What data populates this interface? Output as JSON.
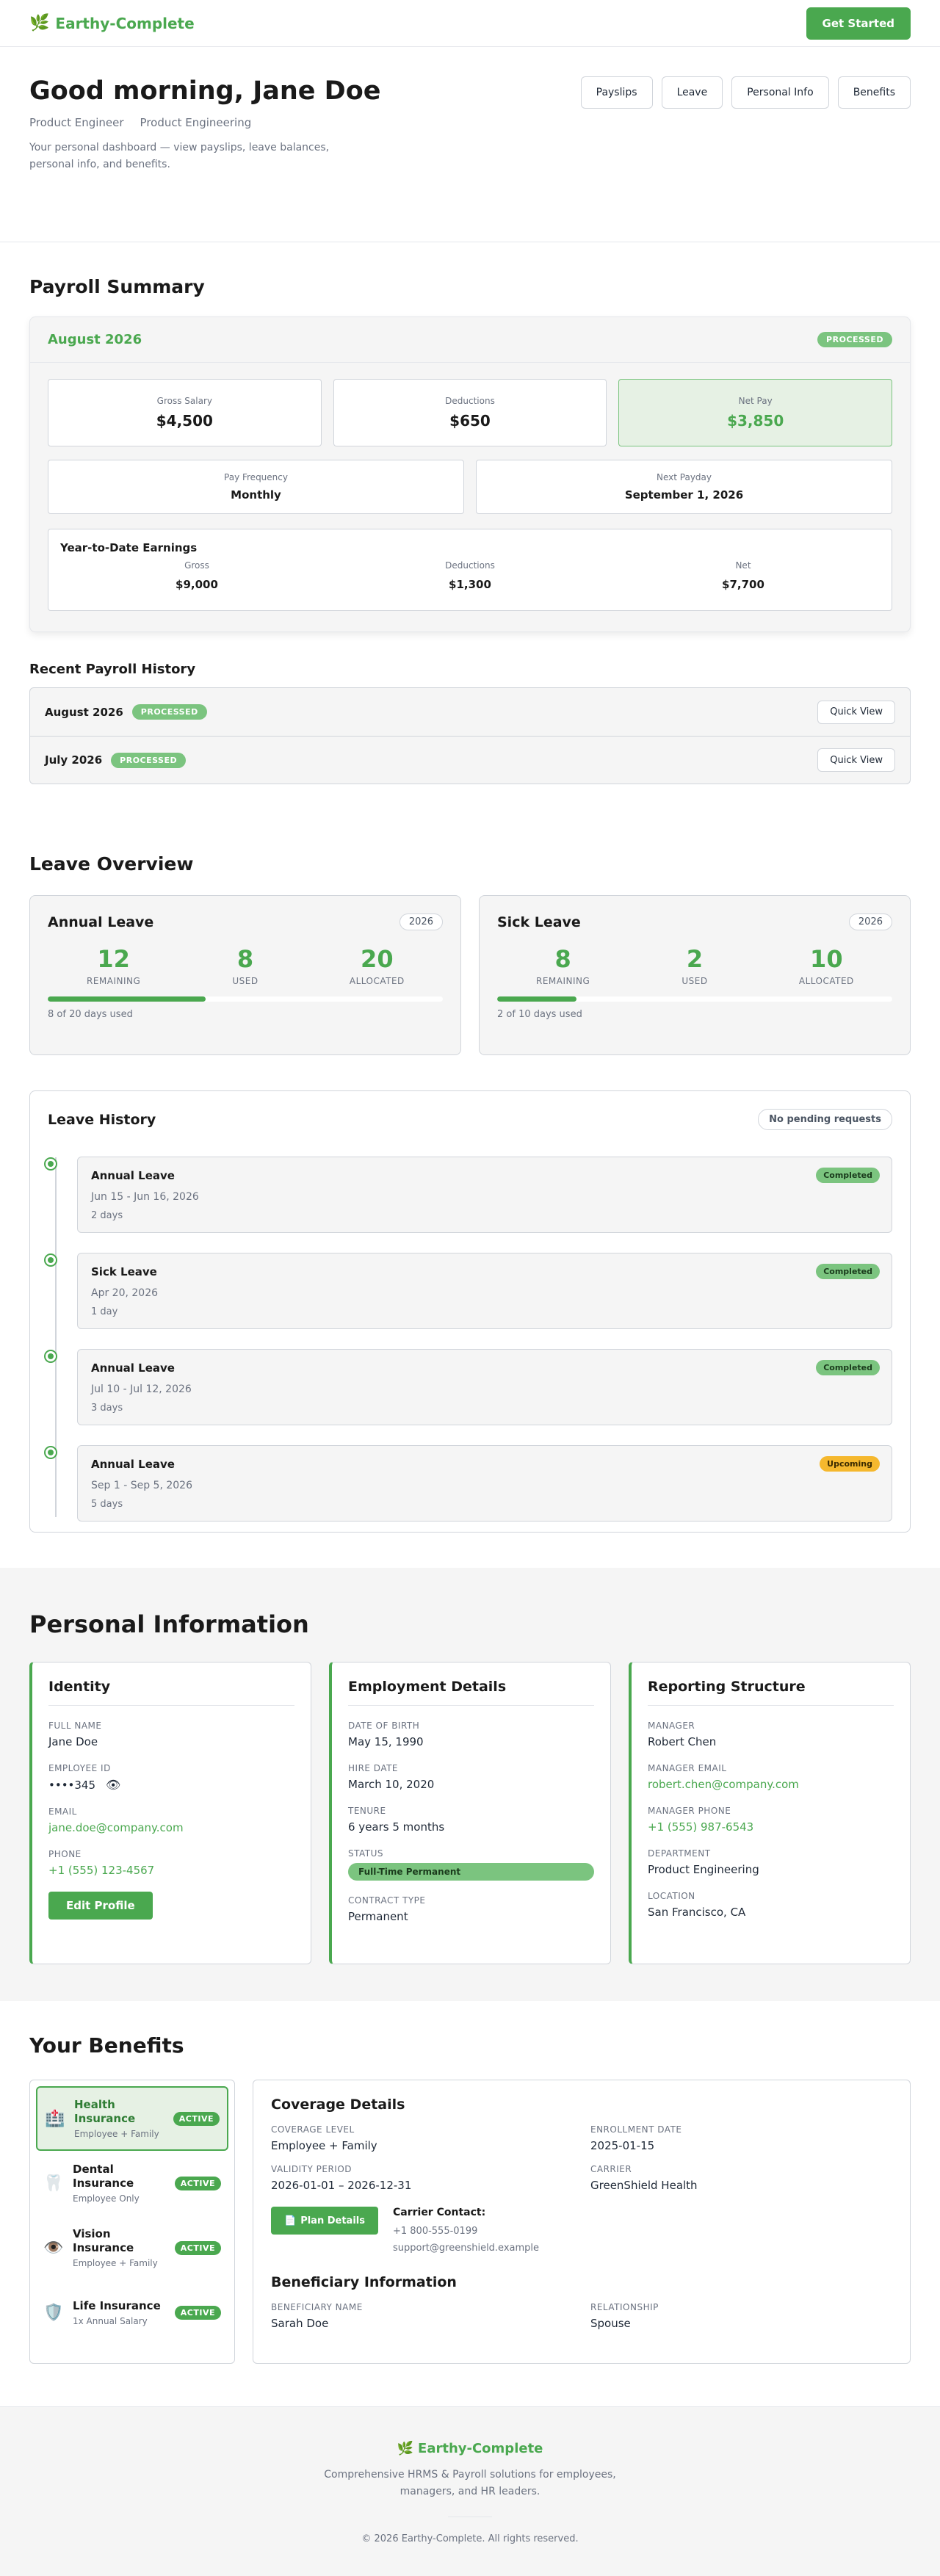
{
  "nav": {
    "brand": "Earthy-Complete",
    "cta": "Get Started"
  },
  "hero": {
    "greeting": "Good morning, Jane Doe",
    "role": "Product Engineer",
    "department": "Product Engineering",
    "description": "Your personal dashboard — view payslips, leave balances, personal info, and benefits.",
    "tabs": [
      "Payslips",
      "Leave",
      "Personal Info",
      "Benefits"
    ]
  },
  "payroll": {
    "title": "Payroll Summary",
    "month": "August 2026",
    "status": "PROCESSED",
    "gross_label": "Gross Salary",
    "gross": "$4,500",
    "deductions_label": "Deductions",
    "deductions": "$650",
    "net_label": "Net Pay",
    "net": "$3,850",
    "frequency_label": "Pay Frequency",
    "frequency": "Monthly",
    "payday_label": "Next Payday",
    "payday": "September 1, 2026",
    "ytd": {
      "title": "Year-to-Date Earnings",
      "gross_label": "Gross",
      "gross": "$9,000",
      "deductions_label": "Deductions",
      "deductions": "$1,300",
      "net_label": "Net",
      "net": "$7,700"
    },
    "history_title": "Recent Payroll History",
    "history": [
      {
        "month": "August 2026",
        "status": "PROCESSED",
        "action": "Quick View"
      },
      {
        "month": "July 2026",
        "status": "PROCESSED",
        "action": "Quick View"
      }
    ]
  },
  "leave": {
    "title": "Leave Overview",
    "cards": [
      {
        "name": "Annual Leave",
        "year": "2026",
        "remaining": "12",
        "used": "8",
        "allocated": "20",
        "remaining_label": "REMAINING",
        "used_label": "USED",
        "allocated_label": "ALLOCATED",
        "progress": 0.4,
        "note": "8 of 20 days used"
      },
      {
        "name": "Sick Leave",
        "year": "2026",
        "remaining": "8",
        "used": "2",
        "allocated": "10",
        "remaining_label": "REMAINING",
        "used_label": "USED",
        "allocated_label": "ALLOCATED",
        "progress": 0.2,
        "note": "2 of 10 days used"
      }
    ],
    "history_title": "Leave History",
    "pending": "No pending requests",
    "history": [
      {
        "type": "Annual Leave",
        "dates": "Jun 15 - Jun 16, 2026",
        "days": "2 days",
        "status": "Completed"
      },
      {
        "type": "Sick Leave",
        "dates": "Apr 20, 2026",
        "days": "1 day",
        "status": "Completed"
      },
      {
        "type": "Annual Leave",
        "dates": "Jul 10 - Jul 12, 2026",
        "days": "3 days",
        "status": "Completed"
      },
      {
        "type": "Annual Leave",
        "dates": "Sep 1 - Sep 5, 2026",
        "days": "5 days",
        "status": "Upcoming"
      }
    ]
  },
  "personal": {
    "title": "Personal Information",
    "identity": {
      "title": "Identity",
      "full_name_label": "FULL NAME",
      "full_name": "Jane Doe",
      "employee_id_label": "EMPLOYEE ID",
      "employee_id": "••••345",
      "email_label": "EMAIL",
      "email": "jane.doe@company.com",
      "phone_label": "PHONE",
      "phone": "+1 (555) 123-4567",
      "edit": "Edit Profile"
    },
    "employment": {
      "title": "Employment Details",
      "dob_label": "DATE OF BIRTH",
      "dob": "May 15, 1990",
      "hire_label": "HIRE DATE",
      "hire": "March 10, 2020",
      "tenure_label": "TENURE",
      "tenure": "6 years 5 months",
      "status_label": "STATUS",
      "status": "Full-Time Permanent",
      "contract_label": "CONTRACT TYPE",
      "contract": "Permanent"
    },
    "reporting": {
      "title": "Reporting Structure",
      "manager_label": "MANAGER",
      "manager": "Robert Chen",
      "manager_email_label": "MANAGER EMAIL",
      "manager_email": "robert.chen@company.com",
      "manager_phone_label": "MANAGER PHONE",
      "manager_phone": "+1 (555) 987-6543",
      "department_label": "DEPARTMENT",
      "department": "Product Engineering",
      "location_label": "LOCATION",
      "location": "San Francisco, CA"
    }
  },
  "benefits": {
    "title": "Your Benefits",
    "items": [
      {
        "icon": "hospital-icon",
        "glyph": "🏥",
        "name": "Health Insurance",
        "sub": "Employee + Family",
        "status": "ACTIVE"
      },
      {
        "icon": "tooth-icon",
        "glyph": "🦷",
        "name": "Dental Insurance",
        "sub": "Employee Only",
        "status": "ACTIVE"
      },
      {
        "icon": "eye-icon",
        "glyph": "👁️",
        "name": "Vision Insurance",
        "sub": "Employee + Family",
        "status": "ACTIVE"
      },
      {
        "icon": "shield-icon",
        "glyph": "🛡️",
        "name": "Life Insurance",
        "sub": "1x Annual Salary",
        "status": "ACTIVE"
      }
    ],
    "detail": {
      "title": "Coverage Details",
      "coverage_label": "COVERAGE LEVEL",
      "coverage": "Employee + Family",
      "enrollment_label": "ENROLLMENT DATE",
      "enrollment": "2025-01-15",
      "validity_label": "VALIDITY PERIOD",
      "validity": "2026-01-01 – 2026-12-31",
      "carrier_label": "CARRIER",
      "carrier": "GreenShield Health",
      "plan_button": "Plan Details",
      "carrier_contact_title": "Carrier Contact:",
      "carrier_phone": "+1 800-555-0199",
      "carrier_email": "support@greenshield.example",
      "beneficiary_title": "Beneficiary Information",
      "beneficiary_name_label": "BENEFICIARY NAME",
      "beneficiary_name": "Sarah Doe",
      "relationship_label": "RELATIONSHIP",
      "relationship": "Spouse"
    }
  },
  "footer": {
    "brand": "Earthy-Complete",
    "description": "Comprehensive HRMS & Payroll solutions for employees, managers, and HR leaders.",
    "copyright": "© 2026 Earthy-Complete. All rights reserved."
  },
  "colors": {
    "accent": "#4aa84f",
    "accent_light": "#7bc47f",
    "upcoming": "#f5b82e"
  }
}
